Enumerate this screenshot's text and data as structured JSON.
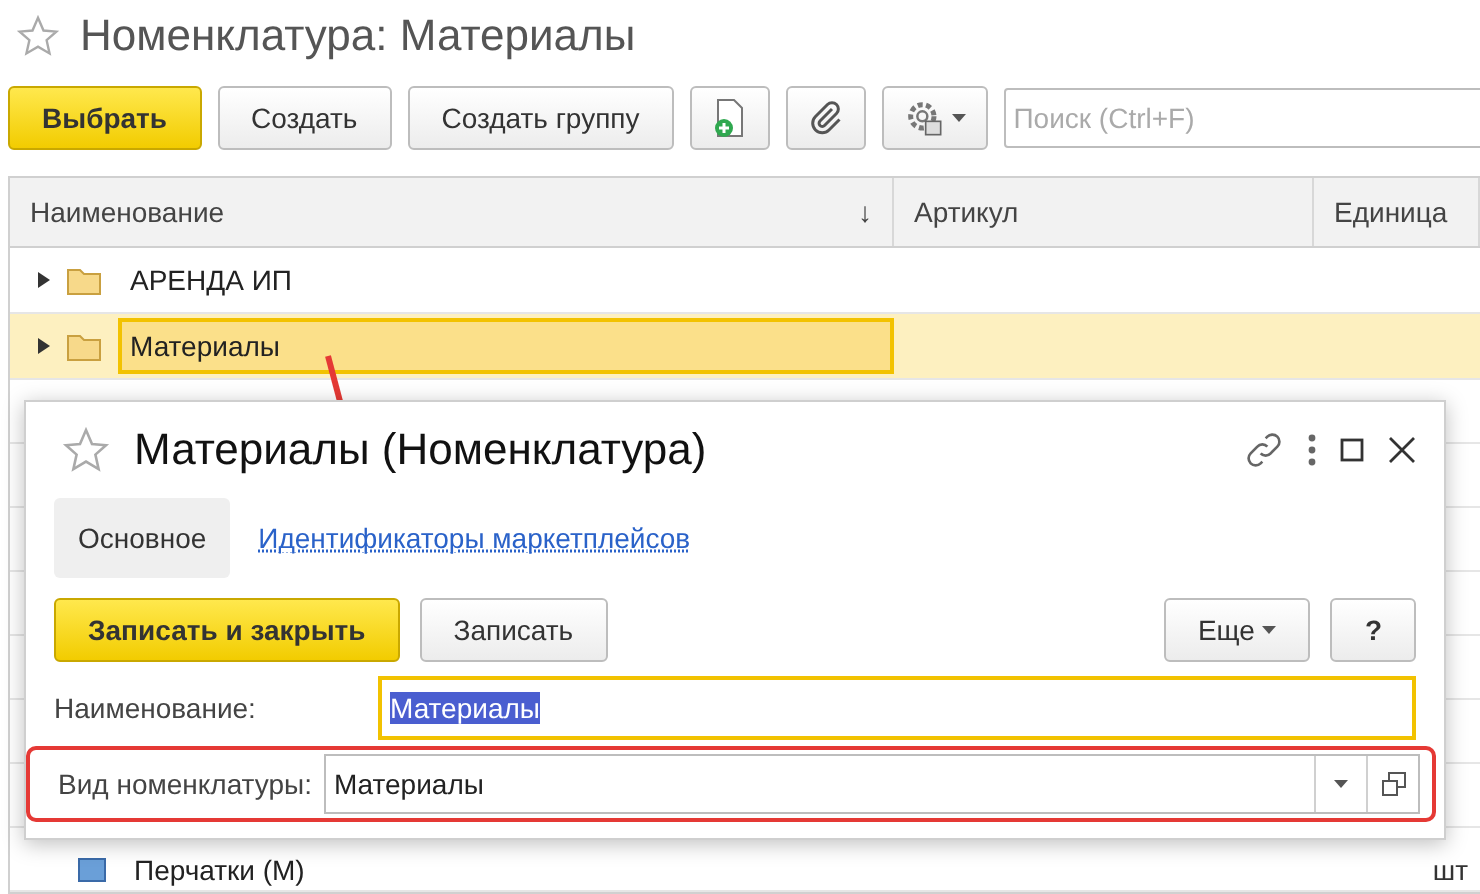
{
  "window": {
    "title": "Номенклатура: Материалы"
  },
  "toolbar": {
    "buttons": [
      {
        "kind": "primary",
        "label": "Выбрать"
      },
      {
        "kind": "plain",
        "label": "Создать"
      },
      {
        "kind": "plain",
        "label": "Создать группу"
      },
      {
        "kind": "add"
      },
      {
        "kind": "clip"
      },
      {
        "kind": "gear"
      }
    ],
    "search": {
      "placeholder": "Поиск (Ctrl+F)"
    }
  },
  "table": {
    "columns": [
      {
        "label": "Наименование",
        "sort": "↓"
      },
      {
        "label": "Артикул"
      },
      {
        "label": "Единица"
      }
    ],
    "rows": [
      {
        "kind": "group",
        "name": "АРЕНДА ИП",
        "selected": false
      },
      {
        "kind": "group",
        "name": "Материалы",
        "selected": true
      },
      {
        "kind": "item",
        "name": "Перчатки (М)",
        "unit": "шт",
        "selected": false
      }
    ]
  },
  "dialog": {
    "title": "Материалы (Номенклатура)",
    "tabs": [
      {
        "label": "Основное",
        "selected": true
      },
      {
        "label": "Идентификаторы маркетплейсов",
        "selected": false
      }
    ],
    "buttons": [
      {
        "kind": "primary",
        "label": "Записать и закрыть"
      },
      {
        "kind": "plain",
        "label": "Записать"
      }
    ],
    "more": "Еще",
    "help": "?",
    "fields": [
      {
        "kind": "text",
        "label": "Наименование:",
        "value": "Материалы",
        "focused": true,
        "highlighted": false
      },
      {
        "kind": "select",
        "label": "Вид номенклатуры:",
        "value": "Материалы",
        "focused": false,
        "highlighted": true
      }
    ]
  }
}
